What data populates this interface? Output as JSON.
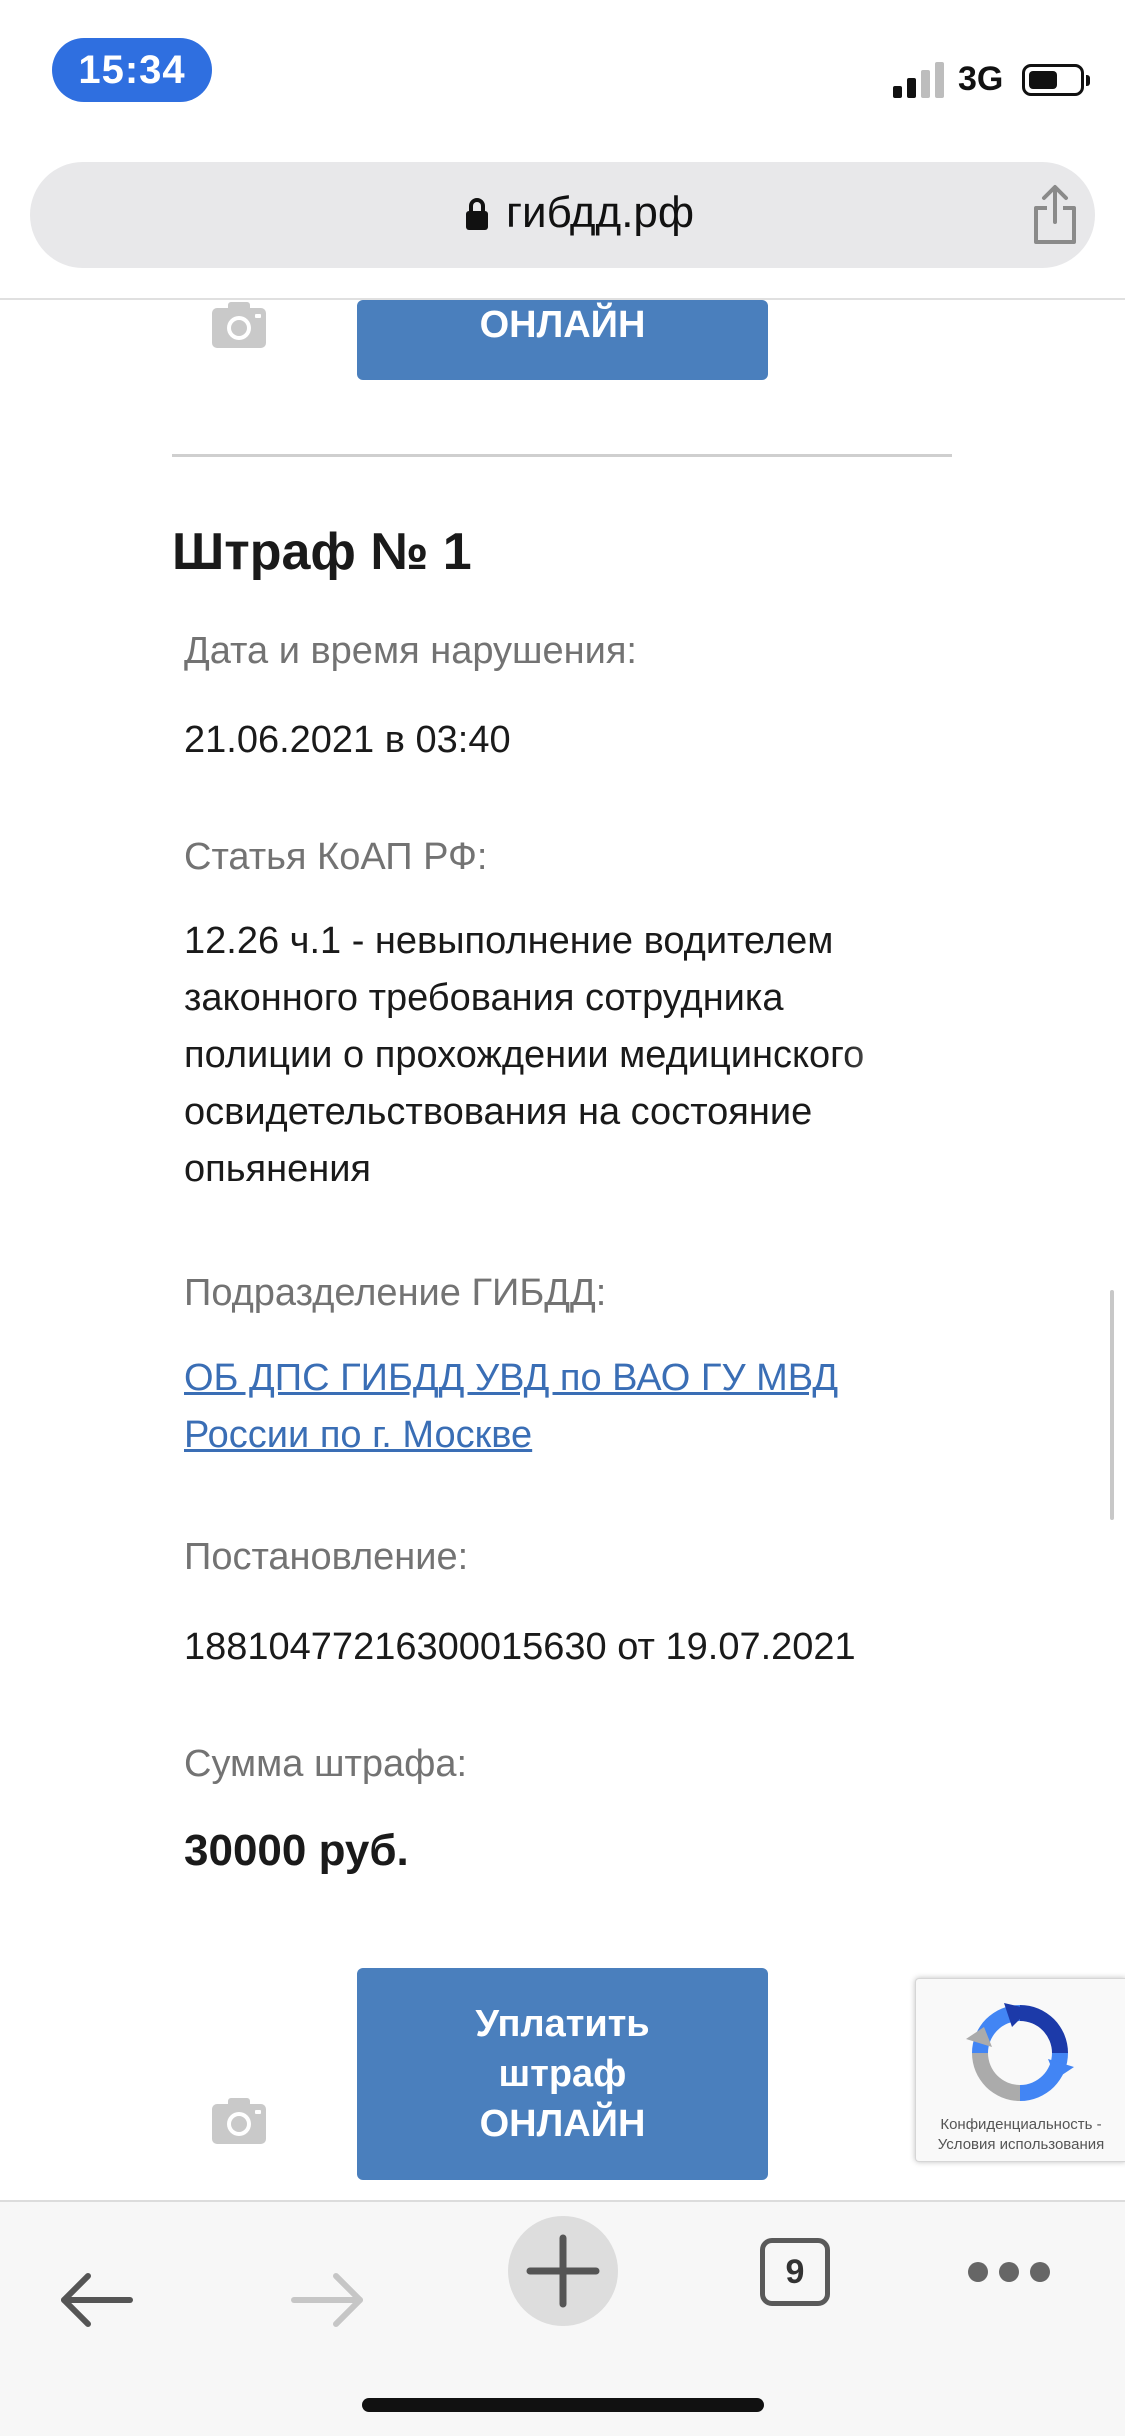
{
  "status_bar": {
    "time": "15:34",
    "network": "3G"
  },
  "browser": {
    "domain": "гибдд.рф",
    "tab_count": "9"
  },
  "top_button": {
    "label": "ОНЛАЙН"
  },
  "fine": {
    "title": "Штраф № 1",
    "date_label": "Дата и время нарушения:",
    "date_value": "21.06.2021 в 03:40",
    "article_label": "Статья КоАП РФ:",
    "article_value": "12.26 ч.1 - невыполнение водителем\nзаконного требования сотрудника\nполиции о прохождении медицинского\nосвидетельствования на состояние\nопьянения",
    "division_label": "Подразделение ГИБДД:",
    "division_value": "ОБ ДПС ГИБДД УВД по ВАО ГУ МВД\nРоссии по г. Москве",
    "resolution_label": "Постановление:",
    "resolution_value": "18810477216300015630 от 19.07.2021",
    "amount_label": "Сумма штрафа:",
    "amount_value": "30000 руб."
  },
  "pay_button": {
    "line1": "Уплатить",
    "line2": "штраф",
    "line3": "ОНЛАЙН"
  },
  "recaptcha": {
    "privacy": "Конфиденциальность -",
    "terms": "Условия использования"
  },
  "colors": {
    "accent": "#4a7fbd",
    "link": "#3a6eb5",
    "time_pill": "#2f6fe0"
  }
}
